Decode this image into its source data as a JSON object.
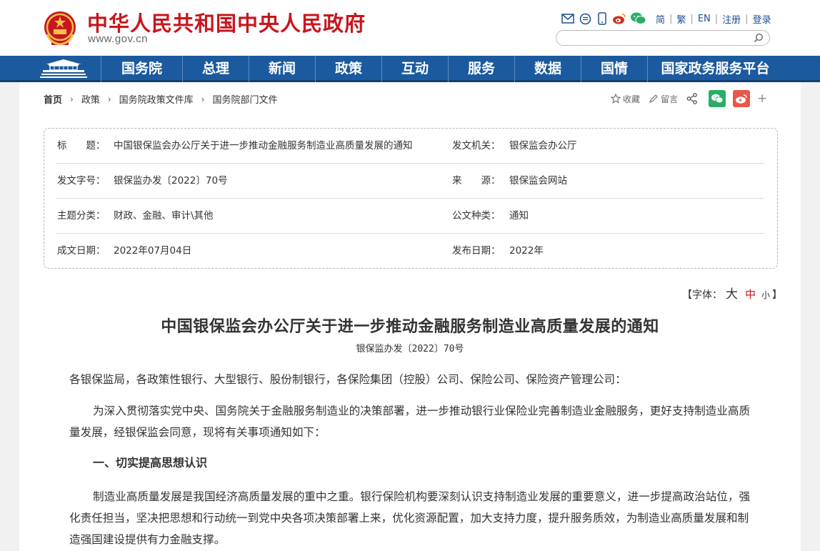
{
  "header": {
    "site_title": "中华人民共和国中央人民政府",
    "site_url": "www.gov.cn",
    "lang_links": [
      {
        "label": "简"
      },
      {
        "label": "繁"
      },
      {
        "label": "EN"
      },
      {
        "label": "注册"
      },
      {
        "label": "登录"
      }
    ],
    "top_icons": [
      "mail-icon",
      "message-icon",
      "mobile-icon",
      "weibo-icon",
      "wechat-icon"
    ],
    "search_placeholder": ""
  },
  "nav": {
    "items": [
      {
        "label": "国务院"
      },
      {
        "label": "总理"
      },
      {
        "label": "新闻"
      },
      {
        "label": "政策"
      },
      {
        "label": "互动"
      },
      {
        "label": "服务"
      },
      {
        "label": "数据"
      },
      {
        "label": "国情"
      },
      {
        "label": "国家政务服务平台"
      }
    ]
  },
  "breadcrumb": {
    "items": [
      {
        "label": "首页"
      },
      {
        "label": "政策"
      },
      {
        "label": "国务院政策文件库"
      },
      {
        "label": "国务院部门文件"
      }
    ]
  },
  "share": {
    "favorite_label": "收藏",
    "comment_label": "留言",
    "plus_label": "+"
  },
  "meta": {
    "title_label": "标　　题：",
    "title_value": "中国银保监会办公厅关于进一步推动金融服务制造业高质量发展的通知",
    "issuer_label": "发文机关：",
    "issuer_value": "银保监会办公厅",
    "docnum_label": "发文字号：",
    "docnum_value": "银保监办发〔2022〕70号",
    "source_label": "来　　源：",
    "source_value": "银保监会网站",
    "topic_label": "主题分类：",
    "topic_value": "财政、金融、审计\\其他",
    "type_label": "公文种类：",
    "type_value": "通知",
    "written_label": "成文日期：",
    "written_value": "2022年07月04日",
    "published_label": "发布日期：",
    "published_value": "2022年"
  },
  "font_size": {
    "prefix": "【字体：",
    "big": "大",
    "mid": "中",
    "small": "小",
    "suffix": "】"
  },
  "article": {
    "title": "中国银保监会办公厅关于进一步推动金融服务制造业高质量发展的通知",
    "doc_number": "银保监办发〔2022〕70号",
    "recipients": "各银保监局，各政策性银行、大型银行、股份制银行，各保险集团（控股）公司、保险公司、保险资产管理公司：",
    "intro": "为深入贯彻落实党中央、国务院关于金融服务制造业的决策部署，进一步推动银行业保险业完善制造业金融服务，更好支持制造业高质量发展，经银保监会同意，现将有关事项通知如下：",
    "section1_heading": "一、切实提高思想认识",
    "section1_body": "制造业高质量发展是我国经济高质量发展的重中之重。银行保险机构要深刻认识支持制造业发展的重要意义，进一步提高政治站位，强化责任担当，坚决把思想和行动统一到党中央各项决策部署上来，优化资源配置，加大支持力度，提升服务质效，为制造业高质量发展和制造强国建设提供有力金融支撑。"
  },
  "colors": {
    "brand_red": "#c8161d",
    "nav_blue": "#1b5a9e",
    "link_blue": "#1e4f8f",
    "wechat_green": "#2aae67",
    "weibo_orange": "#e8574a"
  }
}
